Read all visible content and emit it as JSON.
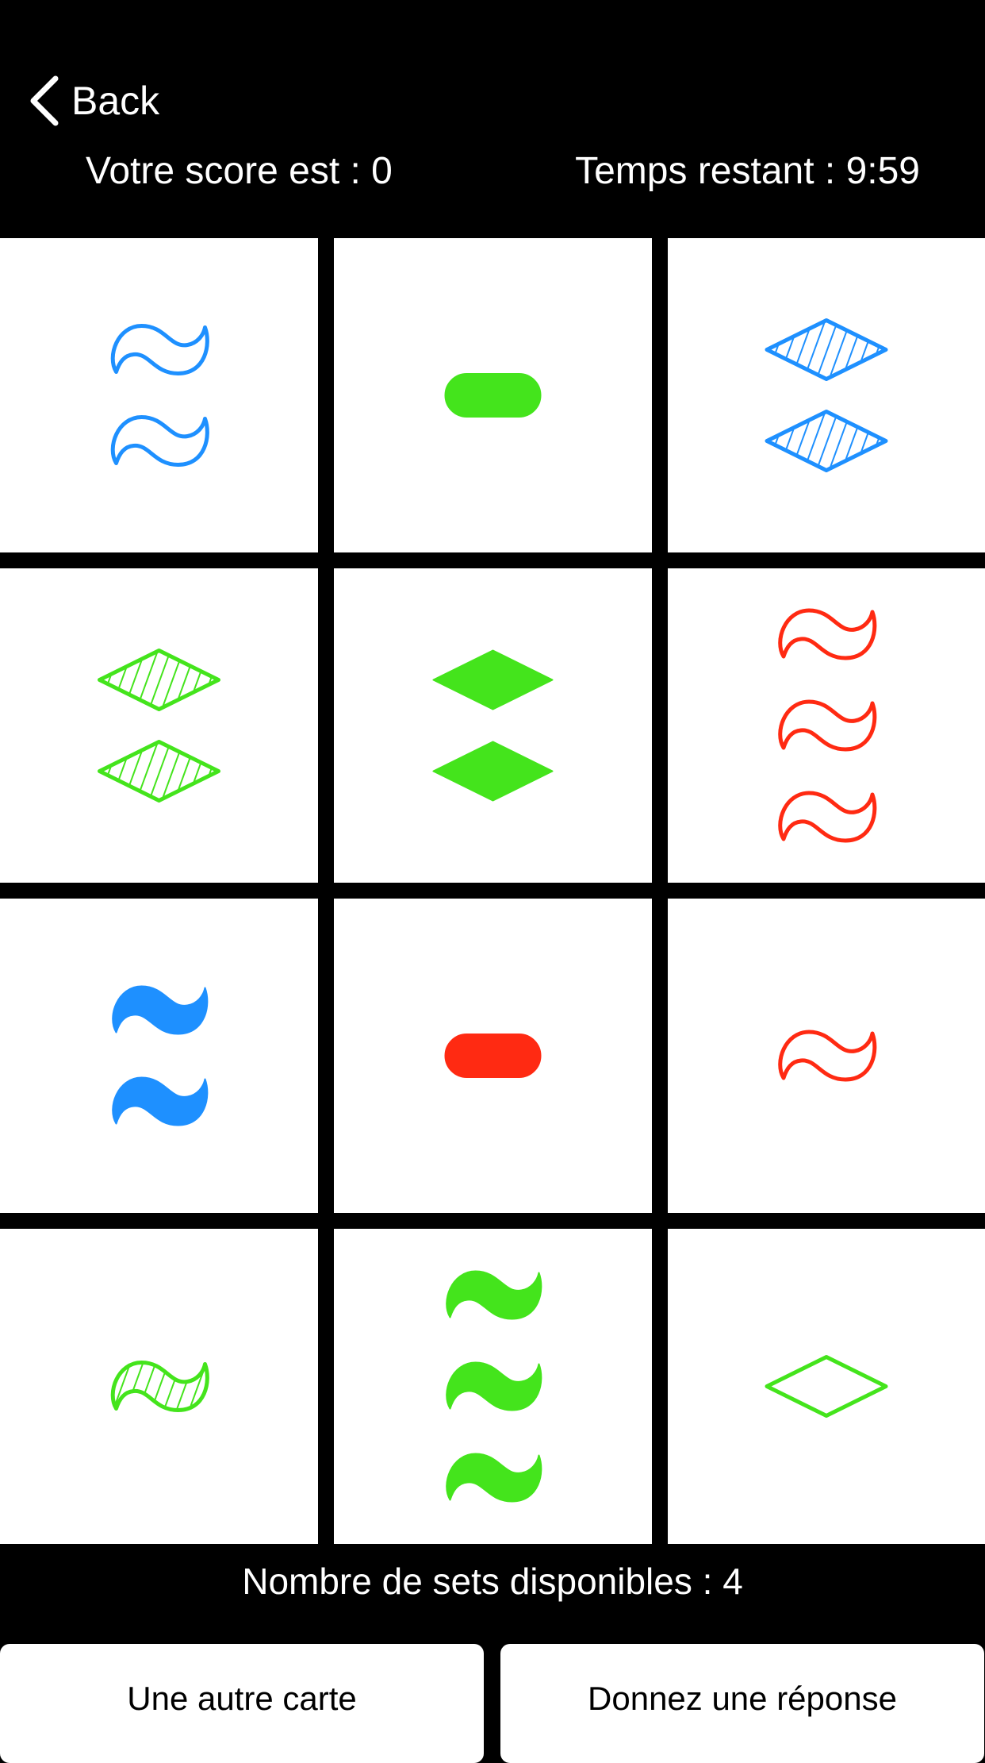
{
  "header": {
    "back_label": "Back",
    "score_text": "Votre score est : 0",
    "timer_text": "Temps restant : 9:59"
  },
  "colors": {
    "blue": "#1E90FF",
    "green": "#44E41C",
    "red": "#FF2A12"
  },
  "cards": [
    {
      "number": 2,
      "shape": "squiggle",
      "color": "blue",
      "shading": "outline"
    },
    {
      "number": 1,
      "shape": "oval",
      "color": "green",
      "shading": "solid"
    },
    {
      "number": 2,
      "shape": "diamond",
      "color": "blue",
      "shading": "striped"
    },
    {
      "number": 2,
      "shape": "diamond",
      "color": "green",
      "shading": "striped"
    },
    {
      "number": 2,
      "shape": "diamond",
      "color": "green",
      "shading": "solid"
    },
    {
      "number": 3,
      "shape": "squiggle",
      "color": "red",
      "shading": "outline"
    },
    {
      "number": 2,
      "shape": "squiggle",
      "color": "blue",
      "shading": "solid"
    },
    {
      "number": 1,
      "shape": "oval",
      "color": "red",
      "shading": "solid"
    },
    {
      "number": 1,
      "shape": "squiggle",
      "color": "red",
      "shading": "outline"
    },
    {
      "number": 1,
      "shape": "squiggle",
      "color": "green",
      "shading": "striped"
    },
    {
      "number": 3,
      "shape": "squiggle",
      "color": "green",
      "shading": "solid"
    },
    {
      "number": 1,
      "shape": "diamond",
      "color": "green",
      "shading": "outline"
    }
  ],
  "footer": {
    "sets_text": "Nombre de sets disponibles : 4",
    "another_card_label": "Une autre carte",
    "answer_label": "Donnez une réponse"
  }
}
